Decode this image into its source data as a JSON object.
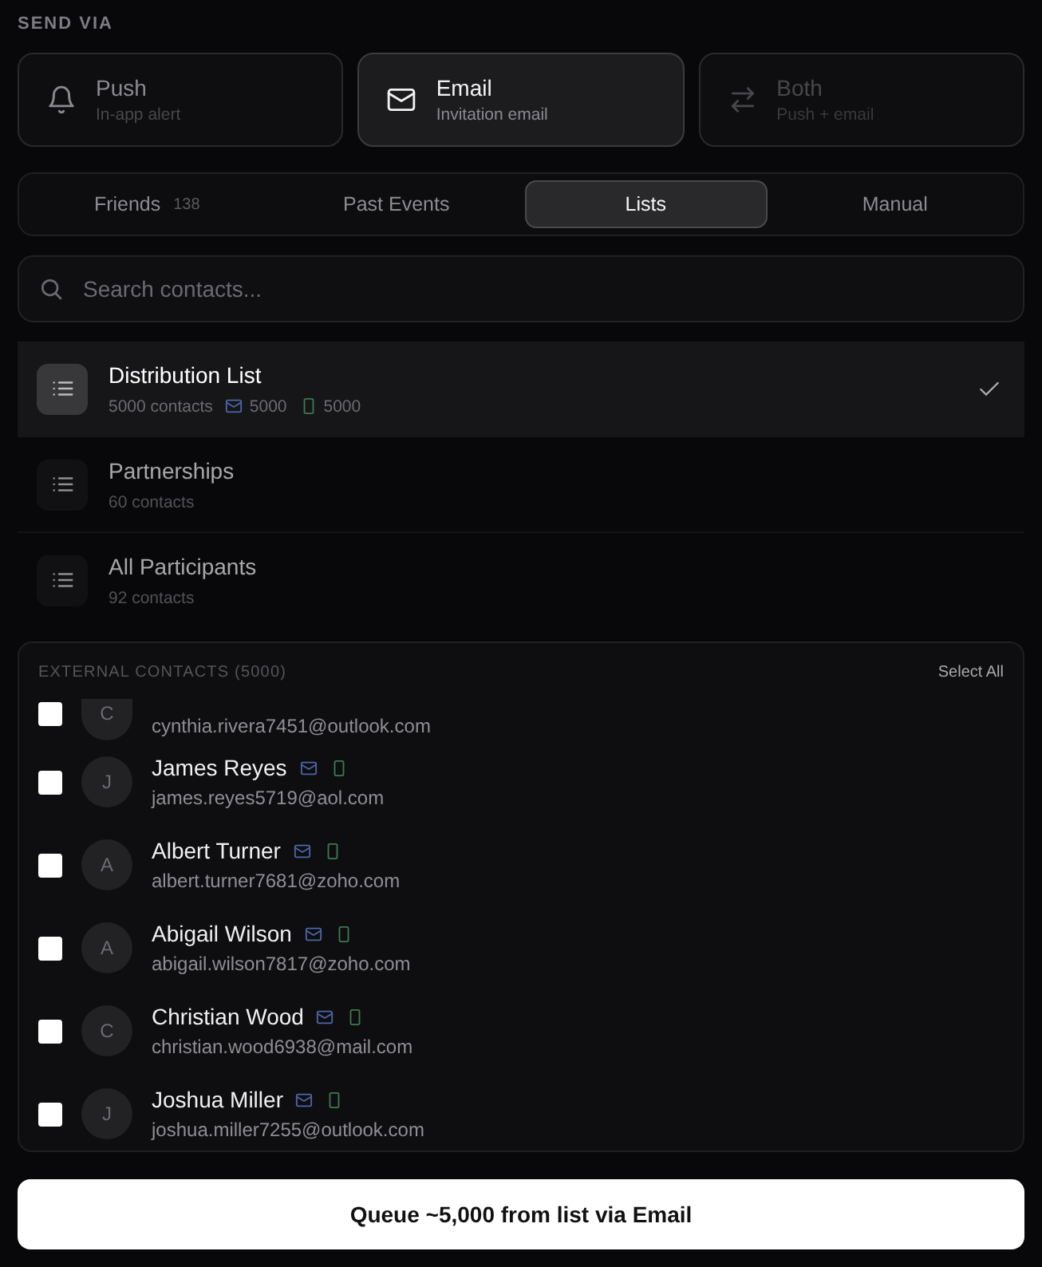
{
  "send_via": {
    "label": "SEND VIA",
    "options": [
      {
        "kind": "push",
        "title": "Push",
        "subtitle": "In-app alert",
        "selected": false,
        "disabled": false
      },
      {
        "kind": "email",
        "title": "Email",
        "subtitle": "Invitation email",
        "selected": true,
        "disabled": false
      },
      {
        "kind": "both",
        "title": "Both",
        "subtitle": "Push + email",
        "selected": false,
        "disabled": true
      }
    ]
  },
  "tabs": [
    {
      "label": "Friends",
      "count": "138",
      "selected": false
    },
    {
      "label": "Past Events",
      "selected": false
    },
    {
      "label": "Lists",
      "selected": true
    },
    {
      "label": "Manual",
      "selected": false
    }
  ],
  "search": {
    "placeholder": "Search contacts..."
  },
  "lists": [
    {
      "name": "Distribution List",
      "count": "5000 contacts",
      "email_count": "5000",
      "phone_count": "5000",
      "selected": true
    },
    {
      "name": "Partnerships",
      "count": "60 contacts",
      "selected": false
    },
    {
      "name": "All Participants",
      "count": "92 contacts",
      "selected": false
    }
  ],
  "contacts": {
    "title": "EXTERNAL CONTACTS (5000)",
    "select_all": "Select All",
    "rows": [
      {
        "initial": "C",
        "email": "cynthia.rivera7451@outlook.com",
        "checked": false
      },
      {
        "initial": "J",
        "name": "James Reyes",
        "email": "james.reyes5719@aol.com",
        "checked": false
      },
      {
        "initial": "A",
        "name": "Albert Turner",
        "email": "albert.turner7681@zoho.com",
        "checked": false
      },
      {
        "initial": "A",
        "name": "Abigail Wilson",
        "email": "abigail.wilson7817@zoho.com",
        "checked": false
      },
      {
        "initial": "C",
        "name": "Christian Wood",
        "email": "christian.wood6938@mail.com",
        "checked": false
      },
      {
        "initial": "J",
        "name": "Joshua Miller",
        "email": "joshua.miller7255@outlook.com",
        "checked": false
      }
    ]
  },
  "action_button": "Queue ~5,000 from list via Email"
}
